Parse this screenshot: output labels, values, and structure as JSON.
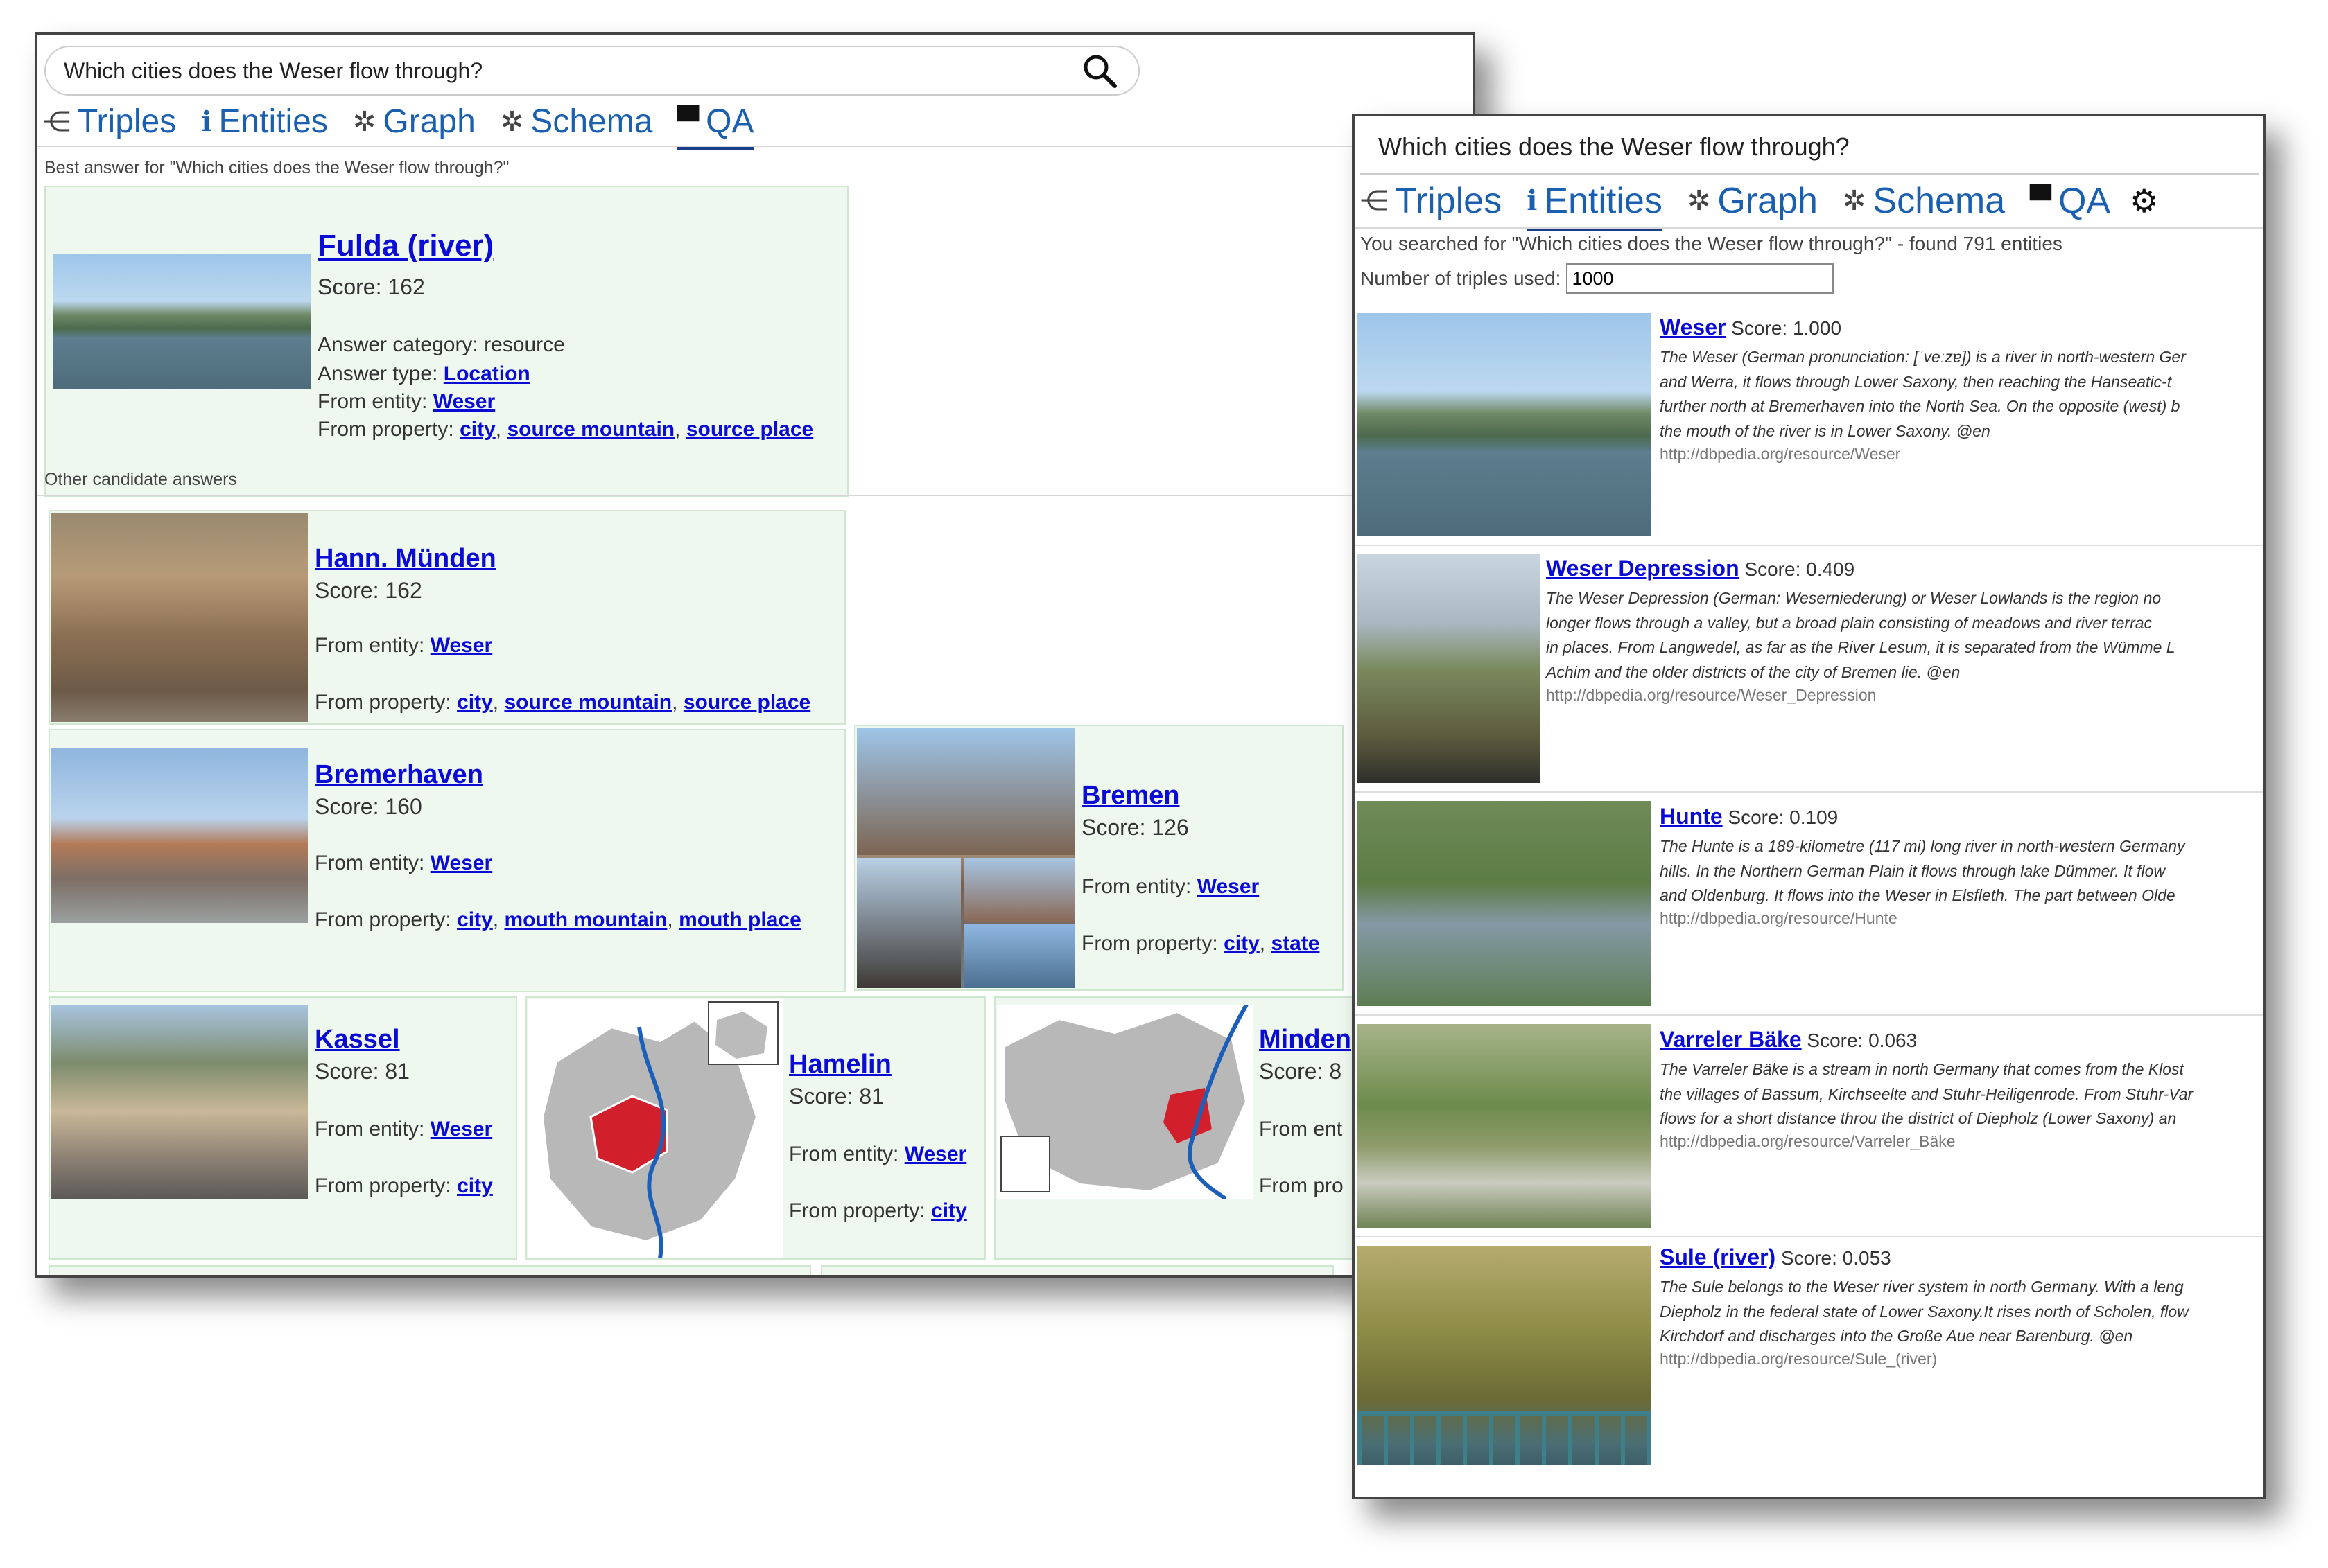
{
  "left": {
    "query": "Which cities does the Weser flow through?",
    "tabs": [
      {
        "label": "Triples",
        "icon": "share-nodes-icon"
      },
      {
        "label": "Entities",
        "icon": "info-person-icon"
      },
      {
        "label": "Graph",
        "icon": "graph-icon"
      },
      {
        "label": "Schema",
        "icon": "schema-icon"
      },
      {
        "label": "QA",
        "icon": "chat-icon"
      }
    ],
    "best_heading": "Best answer for \"Which cities does the Weser flow through?\"",
    "best": {
      "title": "Fulda (river)",
      "score": "Score: 162",
      "category": "Answer category: resource",
      "type_label": "Answer type: ",
      "type_value": "Location",
      "entity_label": "From entity: ",
      "entity_value": "Weser",
      "prop_label": "From property: ",
      "props": [
        "city",
        "source mountain",
        "source place"
      ]
    },
    "other_heading": "Other candidate answers",
    "candidates": [
      {
        "title": "Hann. Münden",
        "score": "Score: 162",
        "entity_label": "From entity: ",
        "entity_value": "Weser",
        "prop_label": "From property: ",
        "props": [
          "city",
          "source mountain",
          "source place"
        ]
      },
      {
        "title": "Bremerhaven",
        "score": "Score: 160",
        "entity_label": "From entity: ",
        "entity_value": "Weser",
        "prop_label": "From property: ",
        "props": [
          "city",
          "mouth mountain",
          "mouth place"
        ]
      },
      {
        "title": "Bremen",
        "score": "Score: 126",
        "entity_label": "From entity: ",
        "entity_value": "Weser",
        "prop_label": "From property: ",
        "props": [
          "city",
          "state"
        ]
      },
      {
        "title": "Kassel",
        "score": "Score: 81",
        "entity_label": "From entity: ",
        "entity_value": "Weser",
        "prop_label": "From property: ",
        "props": [
          "city"
        ]
      },
      {
        "title": "Hamelin",
        "score": "Score: 81",
        "entity_label": "From entity: ",
        "entity_value": "Weser",
        "prop_label": "From property: ",
        "props": [
          "city"
        ]
      },
      {
        "title": "Minden",
        "score": "Score: 8",
        "entity_label": "From ent",
        "entity_value": "",
        "prop_label": "From pro",
        "props": []
      }
    ]
  },
  "right": {
    "query": "Which cities does the Weser flow through?",
    "tabs": [
      {
        "label": "Triples",
        "icon": "share-nodes-icon"
      },
      {
        "label": "Entities",
        "icon": "info-person-icon"
      },
      {
        "label": "Graph",
        "icon": "graph-icon"
      },
      {
        "label": "Schema",
        "icon": "schema-icon"
      },
      {
        "label": "QA",
        "icon": "chat-icon"
      }
    ],
    "summary": "You searched for \"Which cities does the Weser flow through?\" - found 791 entities",
    "triples_label": "Number of triples used:",
    "triples_value": "1000",
    "results": [
      {
        "title": "Weser",
        "score": "Score: 1.000",
        "lines": [
          "The Weser (German pronunciation: [ˈveːzɐ]) is a river in north-western Ger",
          "and Werra, it flows through Lower Saxony, then reaching the Hanseatic-t",
          "further north at Bremerhaven into the North Sea. On the opposite (west) b",
          "the mouth of the river is in Lower Saxony. @en"
        ],
        "uri": "http://dbpedia.org/resource/Weser"
      },
      {
        "title": "Weser Depression",
        "score": "Score: 0.409",
        "lines": [
          "The Weser Depression (German: Weserniederung) or Weser Lowlands is the region no",
          "longer flows through a valley, but a broad plain consisting of meadows and river terrac",
          "in places. From Langwedel, as far as the River Lesum, it is separated from the Wümme L",
          "Achim and the older districts of the city of Bremen lie. @en"
        ],
        "uri": "http://dbpedia.org/resource/Weser_Depression"
      },
      {
        "title": "Hunte",
        "score": "Score: 0.109",
        "lines": [
          "The Hunte is a 189-kilometre (117 mi) long river in north-western Germany",
          "hills. In the Northern German Plain it flows through lake Dümmer. It flow",
          "and Oldenburg. It flows into the Weser in Elsfleth. The part between Olde"
        ],
        "uri": "http://dbpedia.org/resource/Hunte"
      },
      {
        "title": "Varreler Bäke",
        "score": "Score: 0.063",
        "lines": [
          "The Varreler Bäke is a stream in north Germany that comes from the Klost",
          "the villages of Bassum, Kirchseelte and Stuhr-Heiligenrode. From Stuhr-Var",
          "flows for a short distance throu the district of Diepholz (Lower Saxony) an"
        ],
        "uri": "http://dbpedia.org/resource/Varreler_Bäke"
      },
      {
        "title": "Sule (river)",
        "score": "Score: 0.053",
        "lines": [
          "The Sule belongs to the Weser river system in north Germany. With a leng",
          "Diepholz in the federal state of Lower Saxony.It rises north of Scholen, flow",
          "Kirchdorf and discharges into the Große Aue near Barenburg. @en"
        ],
        "uri": "http://dbpedia.org/resource/Sule_(river)"
      }
    ]
  }
}
